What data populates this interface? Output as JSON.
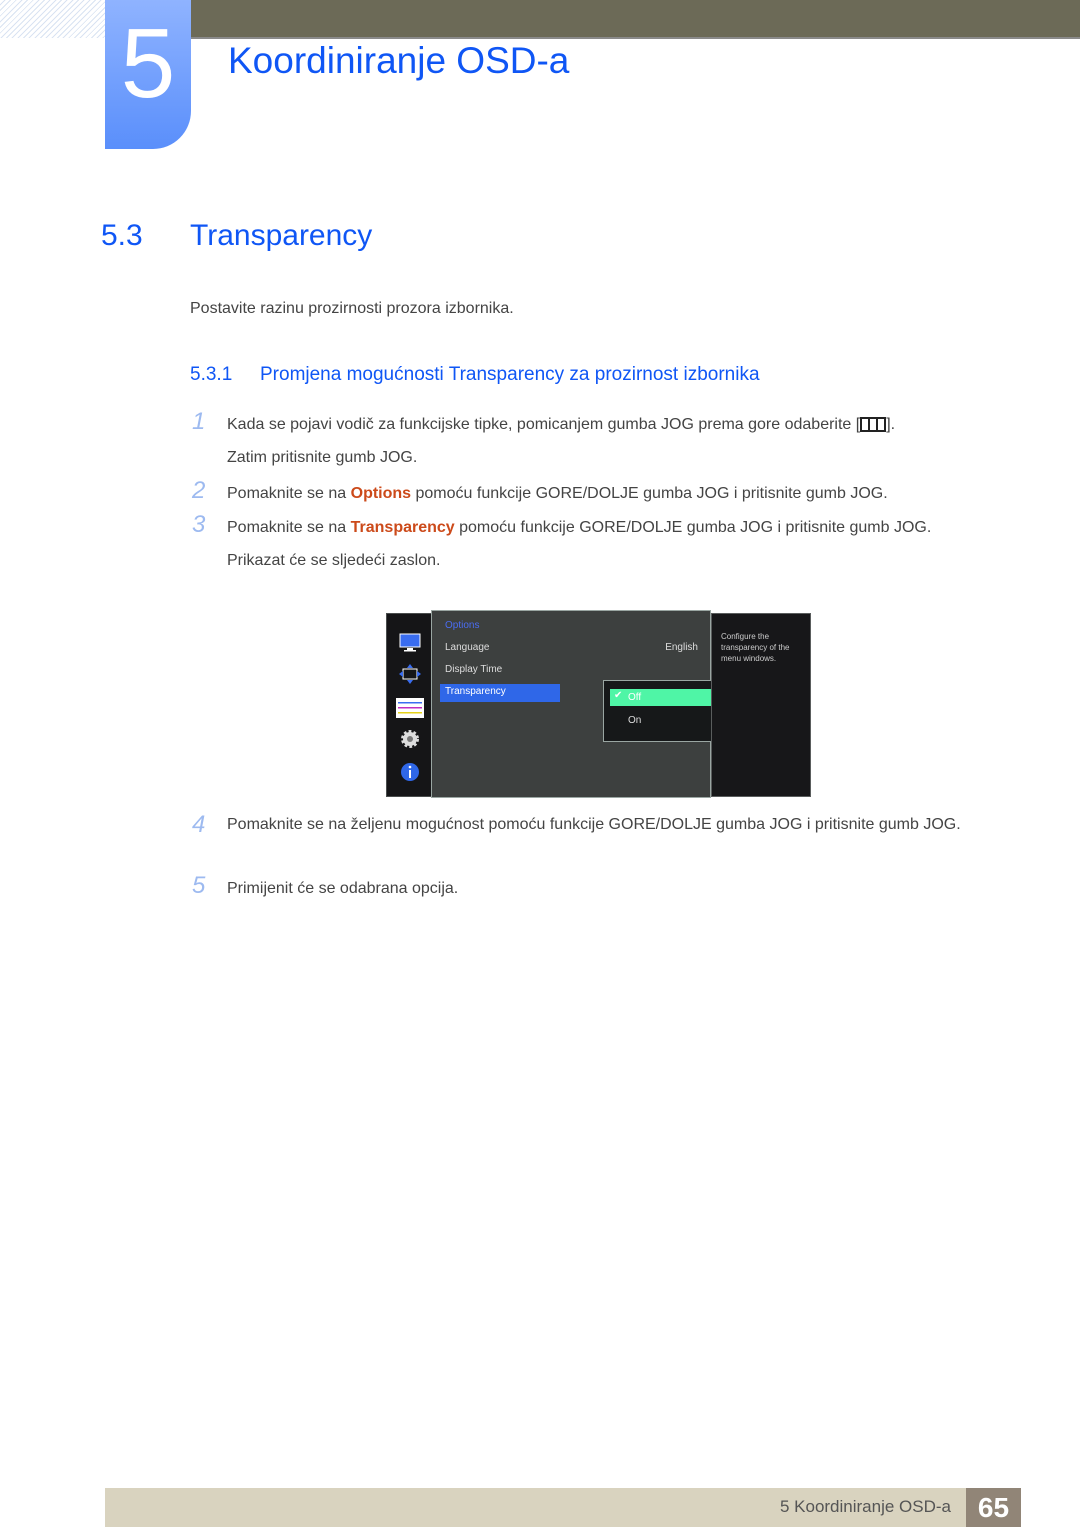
{
  "chapter": {
    "number": "5",
    "title": "Koordiniranje OSD-a"
  },
  "section": {
    "number": "5.3",
    "title": "Transparency",
    "intro": "Postavite razinu prozirnosti prozora izbornika."
  },
  "subsection": {
    "number": "5.3.1",
    "title": "Promjena mogućnosti Transparency za prozirnost izbornika"
  },
  "steps": [
    {
      "num": "1",
      "before": "Kada se pojavi vodič za funkcijske tipke, pomicanjem gumba JOG prema gore odaberite [",
      "icon": "menu-icon",
      "after": "].",
      "line2": "Zatim pritisnite gumb JOG."
    },
    {
      "num": "2",
      "before": "Pomaknite se na ",
      "highlight": "Options",
      "after": " pomoću funkcije GORE/DOLJE gumba JOG i pritisnite gumb JOG."
    },
    {
      "num": "3",
      "before": "Pomaknite se na ",
      "highlight": "Transparency",
      "after": " pomoću funkcije GORE/DOLJE gumba JOG i pritisnite gumb JOG.",
      "line2": "Prikazat će se sljedeći zaslon."
    },
    {
      "num": "4",
      "text": "Pomaknite se na željenu mogućnost pomoću funkcije GORE/DOLJE gumba JOG i pritisnite gumb JOG."
    },
    {
      "num": "5",
      "text": "Primijenit će se odabrana opcija."
    }
  ],
  "osd": {
    "sidebar_icons": [
      "monitor-icon",
      "resize-arrows-icon",
      "picture-settings-icon",
      "gear-icon",
      "info-icon"
    ],
    "category": "Options",
    "items": [
      {
        "label": "Language",
        "value": "English"
      },
      {
        "label": "Display Time",
        "value": ""
      },
      {
        "label": "Transparency",
        "value": ""
      }
    ],
    "selected_item": "Transparency",
    "submenu": {
      "options": [
        "Off",
        "On"
      ],
      "selected": "Off"
    },
    "help_text": "Configure the transparency of the menu windows."
  },
  "footer": {
    "chapter_label": "5 Koordiniranje OSD-a",
    "page": "65"
  },
  "colors": {
    "accent": "#0f56f5",
    "highlight": "#cc4a1a",
    "topbar": "#6c6a57",
    "footer": "#d9d3bf",
    "page_badge": "#918577",
    "osd_selected": "#2f67e8",
    "osd_option_on": "#4ff5a6"
  }
}
